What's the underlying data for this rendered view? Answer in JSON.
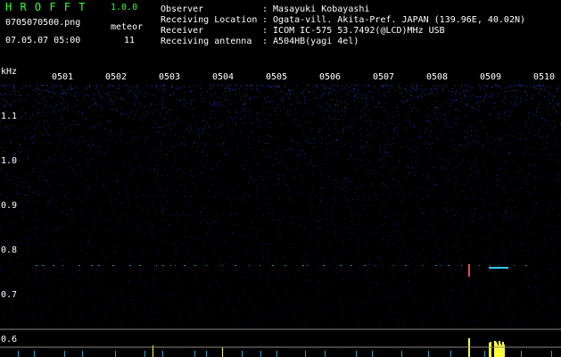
{
  "app": {
    "name": "H R O F F T",
    "version": "1.0.0",
    "file": "0705070500.png",
    "timestamp": "07.05.07 05:00",
    "meteor_label": "meteor",
    "meteor_count": "11"
  },
  "info": {
    "observer_label": "Observer",
    "observer_value": ": Masayuki Kobayashi",
    "location_label": "Receiving Location",
    "location_value": ": Ogata-vill. Akita-Pref. JAPAN (139.96E, 40.02N)",
    "receiver_label": "Receiver",
    "receiver_value": ": ICOM IC-575 53.7492(@LCD)MHz USB",
    "antenna_label": "Receiving antenna",
    "antenna_value": ": A504HB(yagi 4el)"
  },
  "axes": {
    "y_unit": "kHz",
    "y_ticks": [
      "1.1",
      "1.0",
      "0.9",
      "0.8",
      "0.7",
      "0.6"
    ],
    "x_ticks": [
      "0501",
      "0502",
      "0503",
      "0504",
      "0505",
      "0506",
      "0507",
      "0508",
      "0509",
      "0510"
    ]
  },
  "colors": {
    "background": "#000000",
    "header_green": "#33ff33",
    "noise_blue": "#2a2aa8",
    "echo_cyan": "#33ccff",
    "echo_yellow": "#ffff33",
    "guide_line": "#888888"
  }
}
